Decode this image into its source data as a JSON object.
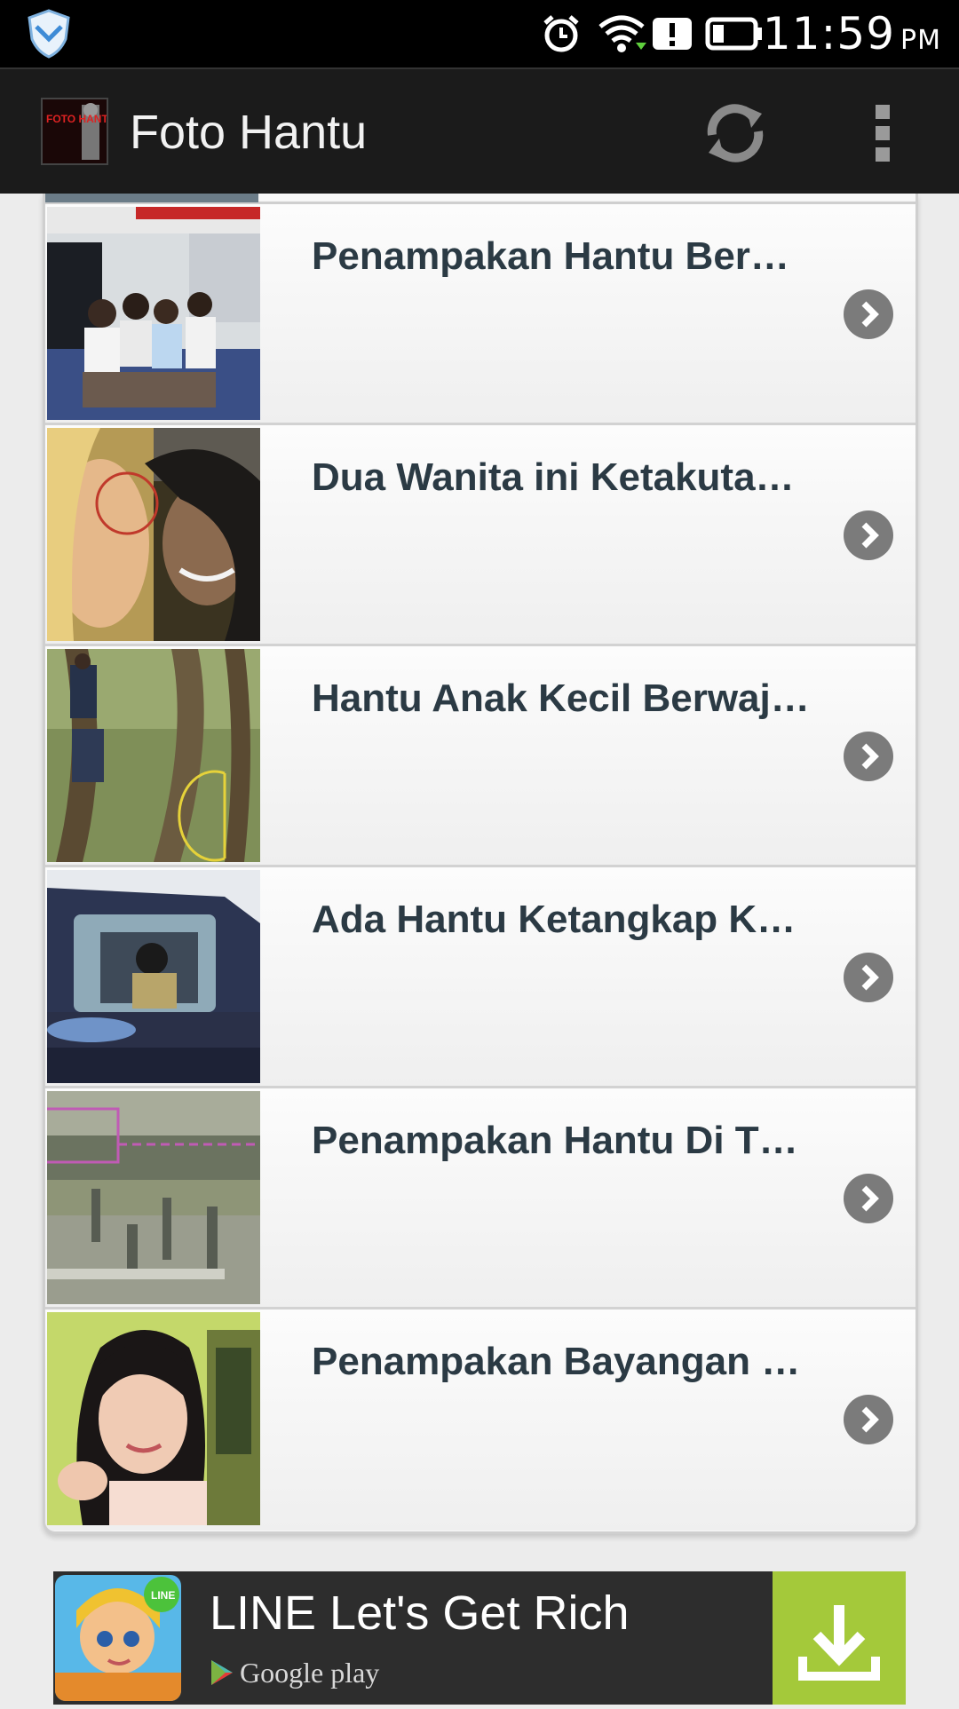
{
  "status_bar": {
    "time": "11:59",
    "ampm": "PM"
  },
  "action_bar": {
    "title": "Foto Hantu",
    "app_icon_text": "FOTO HANTU"
  },
  "list": {
    "items": [
      {
        "title": "Penampakan Hantu Ber…",
        "thumb": "people-on-bus"
      },
      {
        "title": "Dua Wanita ini Ketakuta…",
        "thumb": "two-women-selfie"
      },
      {
        "title": "Hantu Anak Kecil Berwaj…",
        "thumb": "forest-trees"
      },
      {
        "title": "Ada Hantu Ketangkap K…",
        "thumb": "car-window"
      },
      {
        "title": "Penampakan Hantu Di T…",
        "thumb": "cemetery"
      },
      {
        "title": "Penampakan Bayangan …",
        "thumb": "girl-portrait"
      }
    ]
  },
  "ad": {
    "title": "LINE Let's Get Rich",
    "store": "Google play",
    "badge": "LINE",
    "accent": "#a4c93a"
  }
}
